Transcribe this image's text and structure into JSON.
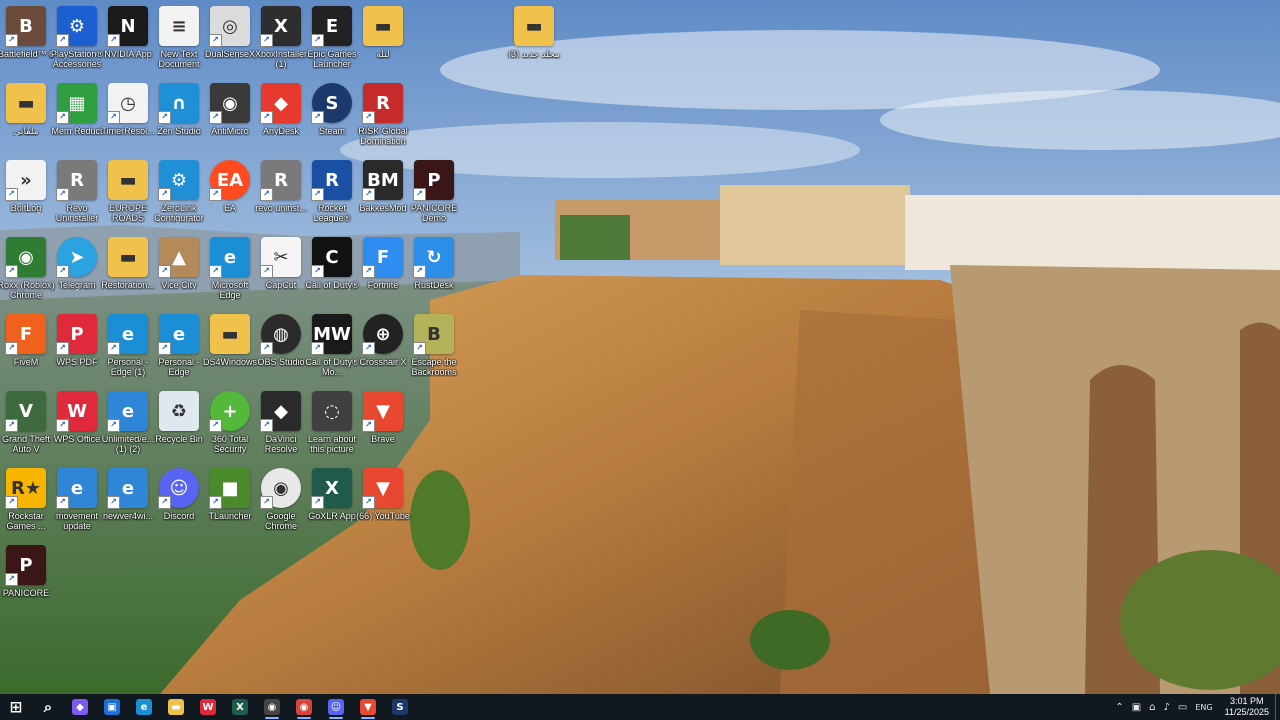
{
  "desktop_icons": [
    {
      "label": "Battlefield™ 6",
      "bg": "#6b4b3a",
      "glyph": "B"
    },
    {
      "label": "PlayStation® Accessories",
      "bg": "#1b5fd1",
      "glyph": "⚙"
    },
    {
      "label": "NVIDIA App",
      "bg": "#1a1a1a",
      "glyph": "N"
    },
    {
      "label": "New Text Document",
      "bg": "#f3f3f3",
      "glyph": "≡"
    },
    {
      "label": "DualSenseX",
      "bg": "#dcdcdc",
      "glyph": "◎"
    },
    {
      "label": "XboxInstaller (1)",
      "bg": "#2e2e2e",
      "glyph": "X"
    },
    {
      "label": "Epic Games Launcher",
      "bg": "#222222",
      "glyph": "E"
    },
    {
      "label": "ليله",
      "bg": "#f0c14b",
      "glyph": "▬"
    },
    {
      "label": "(3) مجلد جديد",
      "bg": "#f0c14b",
      "glyph": "▬"
    },
    {
      "label": "ملفاتي",
      "bg": "#f0c14b",
      "glyph": "▬"
    },
    {
      "label": "Mem Reduct",
      "bg": "#2f9e41",
      "glyph": "▦"
    },
    {
      "label": "TimerResol...",
      "bg": "#f2f2f2",
      "glyph": "◷"
    },
    {
      "label": "Zen Studio",
      "bg": "#1f8fd6",
      "glyph": "∩"
    },
    {
      "label": "AntiMicro",
      "bg": "#3a3a3a",
      "glyph": "◉"
    },
    {
      "label": "AnyDesk",
      "bg": "#e63a2e",
      "glyph": "◆"
    },
    {
      "label": "Steam",
      "bg": "#1b3a6b",
      "glyph": "S"
    },
    {
      "label": "RISK Global Domination",
      "bg": "#c72a2a",
      "glyph": "R"
    },
    {
      "label": "BoltLog",
      "bg": "#f2f2f2",
      "glyph": "»"
    },
    {
      "label": "Revo Uninstaller",
      "bg": "#7a7a7a",
      "glyph": "R"
    },
    {
      "label": "EUROPE ROADS",
      "bg": "#f0c14b",
      "glyph": "▬"
    },
    {
      "label": "ZeroLink Configurator",
      "bg": "#1f8fd6",
      "glyph": "⚙"
    },
    {
      "label": "EA",
      "bg": "#ff4b1f",
      "glyph": "EA"
    },
    {
      "label": "revo uninst...",
      "bg": "#7a7a7a",
      "glyph": "R"
    },
    {
      "label": "Rocket League®",
      "bg": "#1a4fa3",
      "glyph": "R"
    },
    {
      "label": "BakkesMod",
      "bg": "#2a2a2a",
      "glyph": "BM"
    },
    {
      "label": "PANICORE Demo",
      "bg": "#3a1616",
      "glyph": "P"
    },
    {
      "label": "Roxx (Roblox) Chrome",
      "bg": "#2e7d32",
      "glyph": "◉"
    },
    {
      "label": "Telegram",
      "bg": "#2aa3e0",
      "glyph": "➤"
    },
    {
      "label": "Restoration...",
      "bg": "#f0c14b",
      "glyph": "▬"
    },
    {
      "label": "Vice City",
      "bg": "#b48a5a",
      "glyph": "▲"
    },
    {
      "label": "Microsoft Edge",
      "bg": "#1a8fd6",
      "glyph": "e"
    },
    {
      "label": "CapCut",
      "bg": "#f5f5f5",
      "glyph": "✂"
    },
    {
      "label": "Call of Duty®",
      "bg": "#111111",
      "glyph": "C"
    },
    {
      "label": "Fortnite",
      "bg": "#2f8df0",
      "glyph": "F"
    },
    {
      "label": "RustDesk",
      "bg": "#2c8ee6",
      "glyph": "↻"
    },
    {
      "label": "FiveM",
      "bg": "#f0611d",
      "glyph": "F"
    },
    {
      "label": "WPS PDF",
      "bg": "#e0293b",
      "glyph": "P"
    },
    {
      "label": "Personal - Edge (1)",
      "bg": "#1a8fd6",
      "glyph": "e"
    },
    {
      "label": "Personal - Edge",
      "bg": "#1a8fd6",
      "glyph": "e"
    },
    {
      "label": "DS4Windows",
      "bg": "#f0c14b",
      "glyph": "▬"
    },
    {
      "label": "OBS Studio",
      "bg": "#2b2b2b",
      "glyph": "◍"
    },
    {
      "label": "Call of Duty® Mo...",
      "bg": "#1a1a1a",
      "glyph": "MW"
    },
    {
      "label": "Crosshair X",
      "bg": "#222222",
      "glyph": "⊕"
    },
    {
      "label": "Escape the Backrooms",
      "bg": "#b5b35a",
      "glyph": "B"
    },
    {
      "label": "Grand Theft Auto V",
      "bg": "#3d6b3d",
      "glyph": "V"
    },
    {
      "label": "WPS Office",
      "bg": "#e0293b",
      "glyph": "W"
    },
    {
      "label": "Unlimited/e... (1) (2)",
      "bg": "#2f86d6",
      "glyph": "e"
    },
    {
      "label": "Recycle Bin",
      "bg": "#dfe7ef",
      "glyph": "♻"
    },
    {
      "label": "360 Total Security",
      "bg": "#54b83a",
      "glyph": "+"
    },
    {
      "label": "DaVinci Resolve",
      "bg": "#2a2a2a",
      "glyph": "◆"
    },
    {
      "label": "Learn about this picture",
      "bg": "#404040",
      "glyph": "◌"
    },
    {
      "label": "Brave",
      "bg": "#e8482f",
      "glyph": "▼"
    },
    {
      "label": "Rockstar Games ...",
      "bg": "#f7b500",
      "glyph": "R★"
    },
    {
      "label": "movement update",
      "bg": "#2f86d6",
      "glyph": "e"
    },
    {
      "label": "newver4wi...",
      "bg": "#2f86d6",
      "glyph": "e"
    },
    {
      "label": "Discord",
      "bg": "#5865f2",
      "glyph": "☺"
    },
    {
      "label": "TLauncher",
      "bg": "#4a8a2a",
      "glyph": "■"
    },
    {
      "label": "Google Chrome",
      "bg": "#e8e8e8",
      "glyph": "◉"
    },
    {
      "label": "GoXLR App",
      "bg": "#1f5a4a",
      "glyph": "X"
    },
    {
      "label": "(66) YouTube",
      "bg": "#e8482f",
      "glyph": "▼"
    },
    {
      "label": "PANICORE",
      "bg": "#3a1616",
      "glyph": "P"
    }
  ],
  "taskbar": {
    "items": [
      {
        "name": "start-button",
        "glyph": "⊞",
        "bg": "transparent",
        "active": false
      },
      {
        "name": "search-button",
        "glyph": "⌕",
        "bg": "transparent",
        "active": false
      },
      {
        "name": "copilot-taskbar-button",
        "glyph": "◆",
        "bg": "#7a5cf0",
        "active": false
      },
      {
        "name": "store-taskbar-button",
        "glyph": "▣",
        "bg": "#1f6fd6",
        "active": false
      },
      {
        "name": "edge-taskbar-button",
        "glyph": "e",
        "bg": "#1a8fd6",
        "active": false
      },
      {
        "name": "file-explorer-taskbar-button",
        "glyph": "▬",
        "bg": "#f0c14b",
        "active": false
      },
      {
        "name": "wps-taskbar-button",
        "glyph": "W",
        "bg": "#e0293b",
        "active": false
      },
      {
        "name": "goxlr-taskbar-button",
        "glyph": "X",
        "bg": "#1f5a4a",
        "active": false
      },
      {
        "name": "app-taskbar-button",
        "glyph": "◉",
        "bg": "#444444",
        "active": true
      },
      {
        "name": "chrome-taskbar-button",
        "glyph": "◉",
        "bg": "#d6453a",
        "active": true
      },
      {
        "name": "discord-taskbar-button",
        "glyph": "☺",
        "bg": "#5865f2",
        "active": true
      },
      {
        "name": "brave-taskbar-button",
        "glyph": "▼",
        "bg": "#e8482f",
        "active": true
      },
      {
        "name": "steam-taskbar-button",
        "glyph": "S",
        "bg": "#1b3a6b",
        "active": false
      }
    ],
    "tray": {
      "language": "ENG",
      "time": "3:01 PM",
      "date": "11/25/2025"
    }
  }
}
